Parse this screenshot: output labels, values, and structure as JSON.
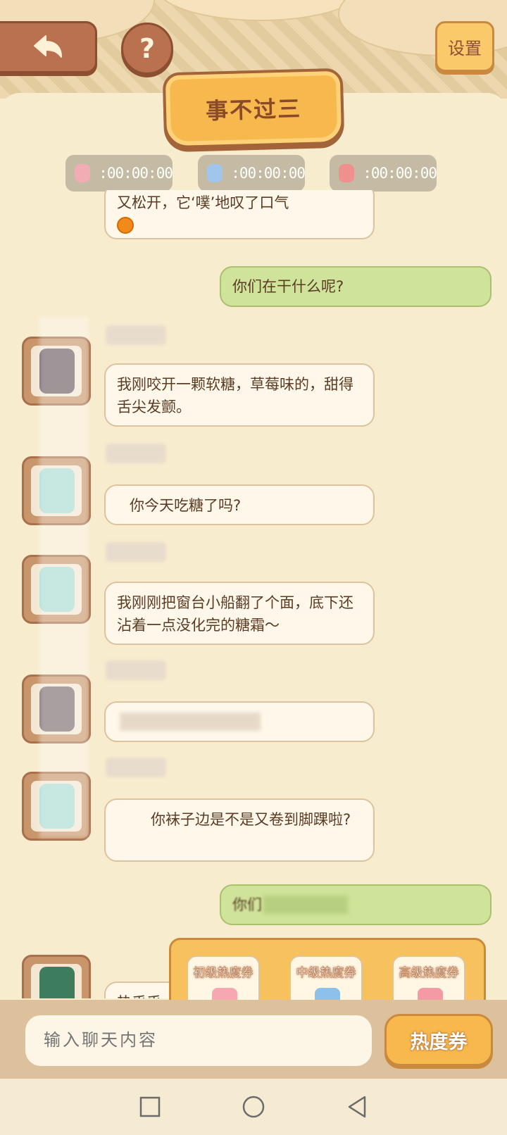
{
  "header": {
    "settings_label": "设置",
    "help_symbol": "?",
    "title": "事不过三"
  },
  "timers": [
    {
      "value": ":00:00:00",
      "icon": "pink-character-icon",
      "color": "#f2a9b2"
    },
    {
      "value": ":00:00:00",
      "icon": "blue-character-icon",
      "color": "#9cc5ee"
    },
    {
      "value": ":00:00:00",
      "icon": "red-character-icon",
      "color": "#ef8b8b"
    }
  ],
  "messages": [
    {
      "type": "incoming",
      "text": "又松开，它‘噗’地叹了口气"
    },
    {
      "type": "outgoing",
      "text": "你们在干什么呢?"
    },
    {
      "type": "incoming",
      "text": "我刚咬开一颗软糖，草莓味的，甜得舌尖发颤。"
    },
    {
      "type": "incoming",
      "text": "你今天吃糖了吗?"
    },
    {
      "type": "incoming",
      "text": "我刚刚把窗台小船翻了个面，底下还沾着一点没化完的糖霜～"
    },
    {
      "type": "incoming",
      "text": ""
    },
    {
      "type": "incoming",
      "text": "你袜子边是不是又卷到脚踝啦?"
    },
    {
      "type": "outgoing",
      "text": "你们"
    },
    {
      "type": "incoming",
      "text": "热乎乎"
    }
  ],
  "tickets": [
    {
      "label": "初级热度券",
      "color": "#f7a7b1"
    },
    {
      "label": "中级热度券",
      "color": "#8ec0ec"
    },
    {
      "label": "高级热度券",
      "color": "#f39aa5"
    }
  ],
  "input": {
    "placeholder": "输入聊天内容",
    "hot_button": "热度券"
  },
  "system_nav": [
    "recent-apps-icon",
    "home-icon",
    "back-icon"
  ]
}
